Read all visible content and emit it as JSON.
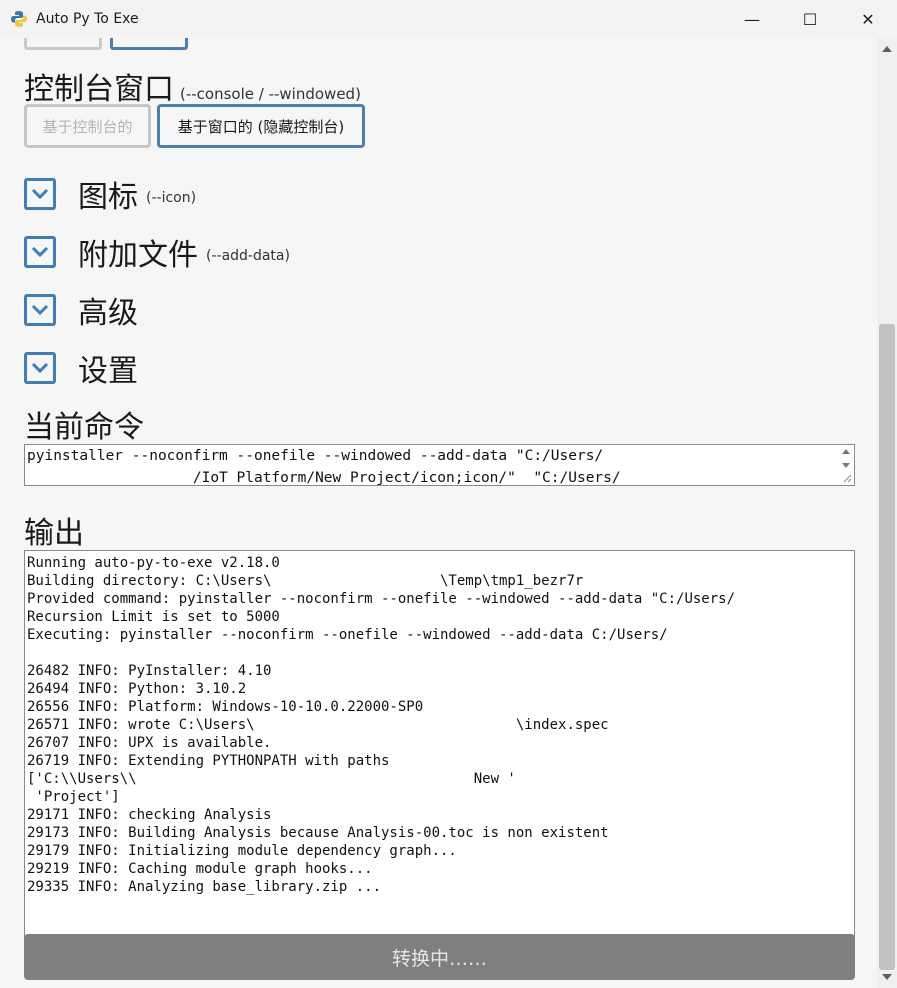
{
  "window": {
    "title": "Auto Py To Exe",
    "controls": {
      "minimize": "—",
      "maximize": "☐",
      "close": "✕"
    }
  },
  "console_section": {
    "title": "控制台窗口",
    "subtitle": "(--console / --windowed)",
    "option_console": "基于控制台的",
    "option_windowed": "基于窗口的 (隐藏控制台)"
  },
  "collapsibles": [
    {
      "label": "图标",
      "sub": "(--icon)"
    },
    {
      "label": "附加文件",
      "sub": "(--add-data)"
    },
    {
      "label": "高级",
      "sub": ""
    },
    {
      "label": "设置",
      "sub": ""
    }
  ],
  "command": {
    "title": "当前命令",
    "line1": "pyinstaller --noconfirm --onefile --windowed --add-data \"C:/Users/",
    "line2": "                   /IoT Platform/New Project/icon;icon/\"  \"C:/Users/"
  },
  "output": {
    "title": "输出",
    "lines": [
      "Running auto-py-to-exe v2.18.0",
      "Building directory: C:\\Users\\                    \\Temp\\tmp1_bezr7r",
      "Provided command: pyinstaller --noconfirm --onefile --windowed --add-data \"C:/Users/",
      "Recursion Limit is set to 5000",
      "Executing: pyinstaller --noconfirm --onefile --windowed --add-data C:/Users/",
      "",
      "26482 INFO: PyInstaller: 4.10",
      "26494 INFO: Python: 3.10.2",
      "26556 INFO: Platform: Windows-10-10.0.22000-SP0",
      "26571 INFO: wrote C:\\Users\\                               \\index.spec",
      "26707 INFO: UPX is available.",
      "26719 INFO: Extending PYTHONPATH with paths",
      "['C:\\\\Users\\\\                                        New '",
      " 'Project']",
      "29171 INFO: checking Analysis",
      "29173 INFO: Building Analysis because Analysis-00.toc is non existent",
      "29179 INFO: Initializing module dependency graph...",
      "29219 INFO: Caching module graph hooks...",
      "29335 INFO: Analyzing base_library.zip ..."
    ]
  },
  "convert_button": {
    "label": "转换中……"
  },
  "colors": {
    "accent": "#3f7fb9",
    "button_gray": "#7f7f7f"
  }
}
